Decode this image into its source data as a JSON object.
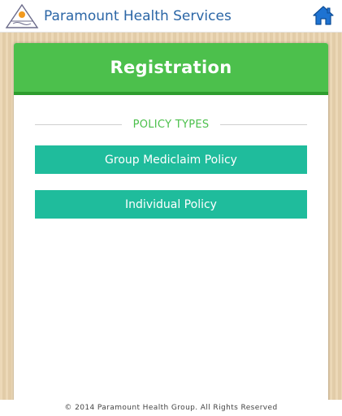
{
  "header": {
    "title": "Paramount Health Services",
    "logo_icon": "paramount-logo-icon",
    "home_icon": "home-icon"
  },
  "card": {
    "title": "Registration",
    "section_label": "POLICY TYPES",
    "buttons": [
      {
        "label": "Group Mediclaim Policy"
      },
      {
        "label": "Individual Policy"
      }
    ]
  },
  "footer": {
    "text": "© 2014 Paramount Health Group. All Rights Reserved"
  },
  "colors": {
    "header_green": "#4cc04c",
    "button_teal": "#1fbc9c",
    "title_blue": "#2b66a6",
    "background_wood": "#e9d3ad"
  }
}
